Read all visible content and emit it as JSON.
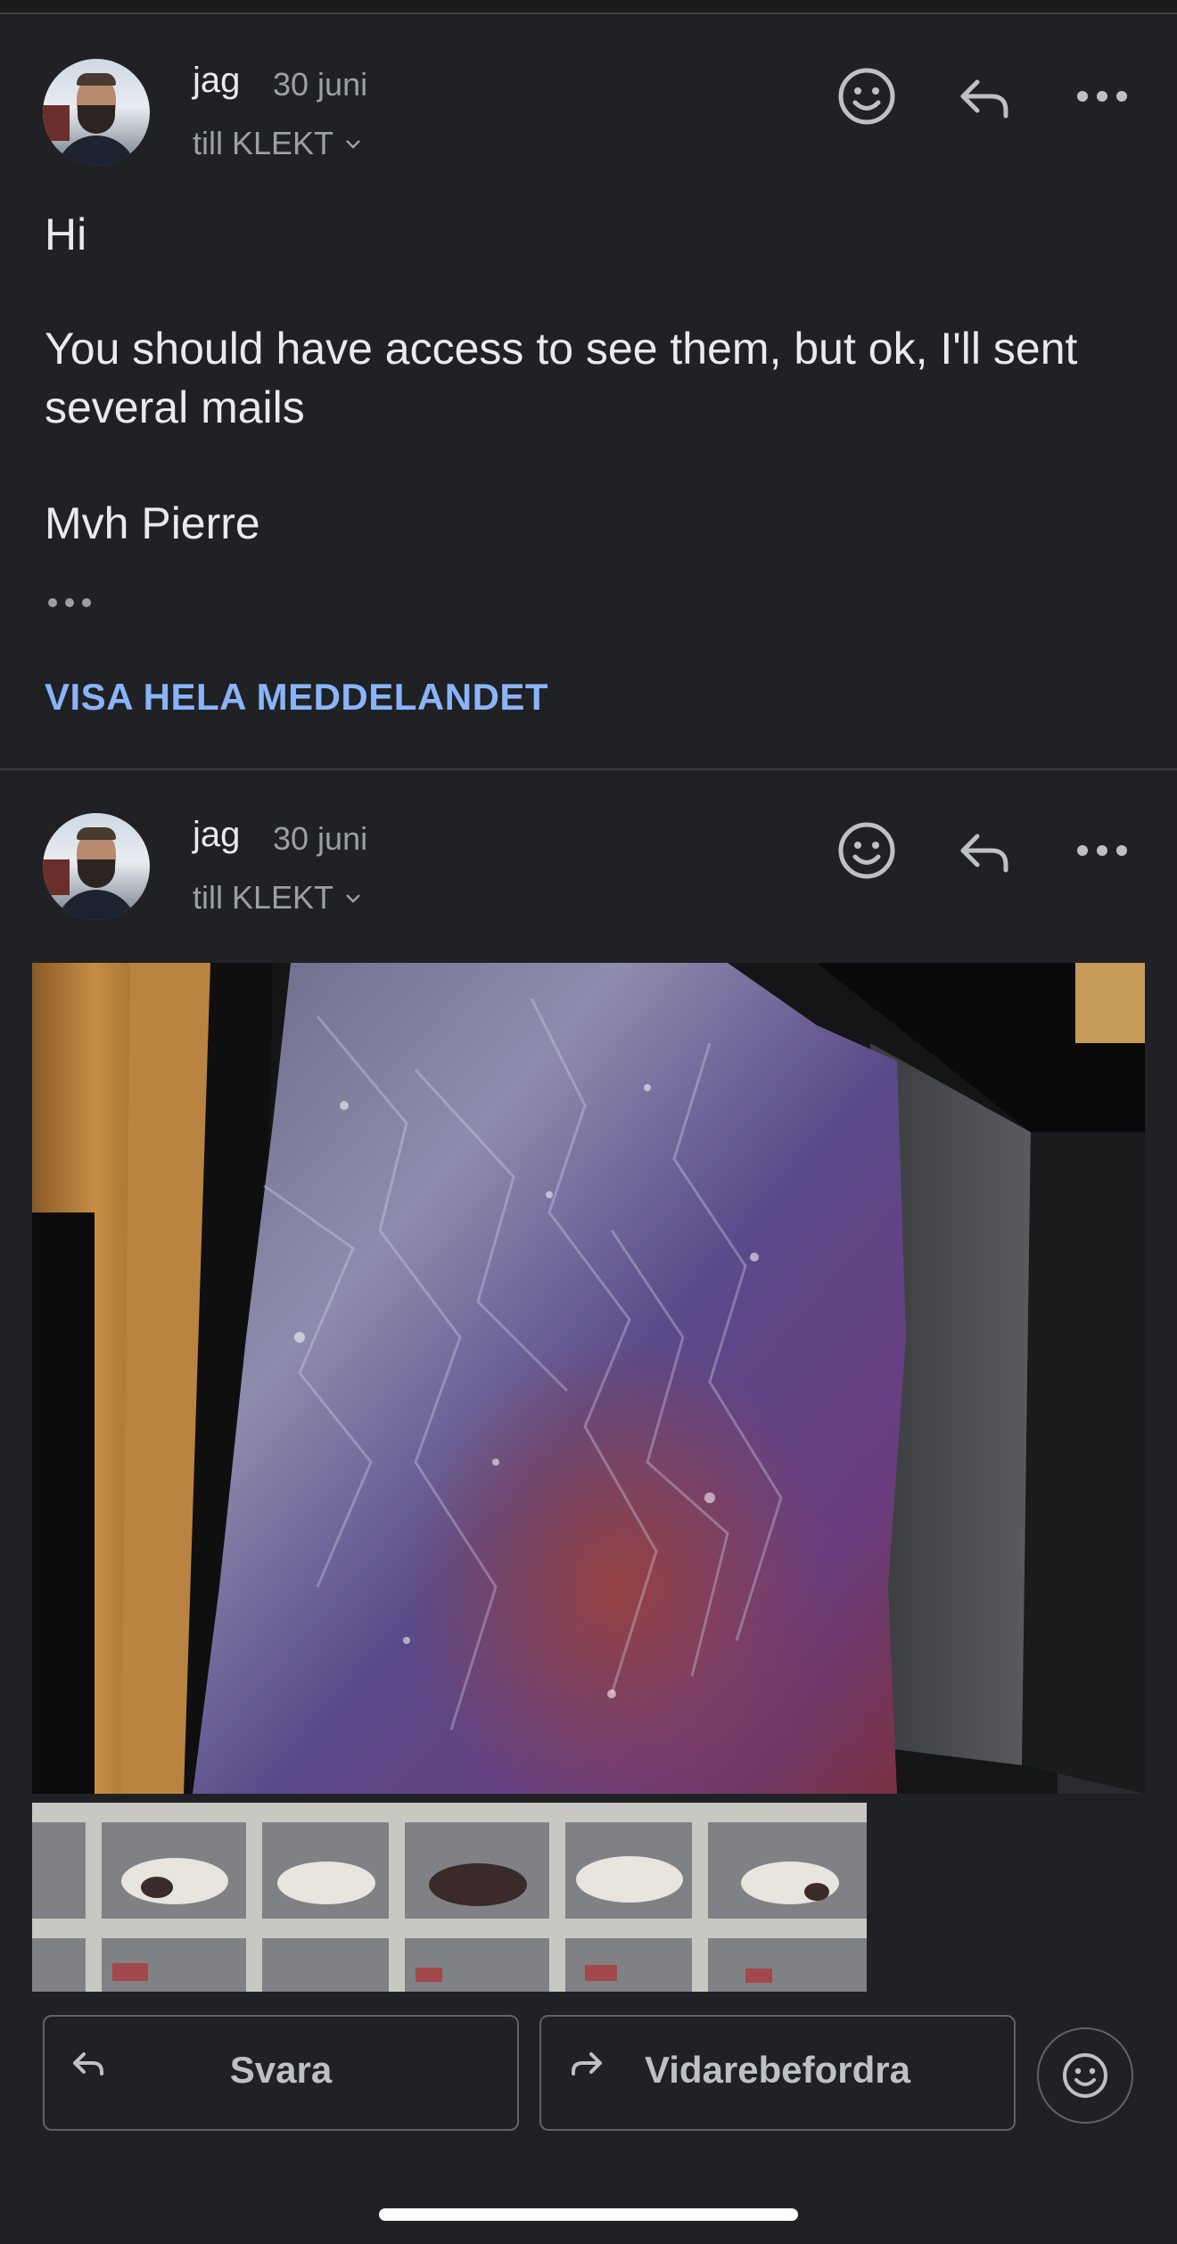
{
  "messages": [
    {
      "sender": "jag",
      "date": "30 juni",
      "recipient": "till KLEKT",
      "body": [
        "Hi",
        "You should have access to see them, but ok, I'll sent several mails",
        "Mvh Pierre"
      ],
      "show_full_label": "VISA HELA MEDDELANDET"
    },
    {
      "sender": "jag",
      "date": "30 juni",
      "recipient": "till KLEKT",
      "attachments": [
        "photo",
        "photo"
      ]
    }
  ],
  "actions": {
    "reply_label": "Svara",
    "forward_label": "Vidarebefordra"
  },
  "icons": {
    "header": [
      "emoji-icon",
      "reply-icon",
      "more-icon"
    ],
    "bottom": [
      "reply-arrow-icon",
      "forward-arrow-icon",
      "emoji-icon"
    ]
  },
  "colors": {
    "background": "#202124",
    "link": "#8ab4f8",
    "secondary_text": "#9aa0a6"
  }
}
